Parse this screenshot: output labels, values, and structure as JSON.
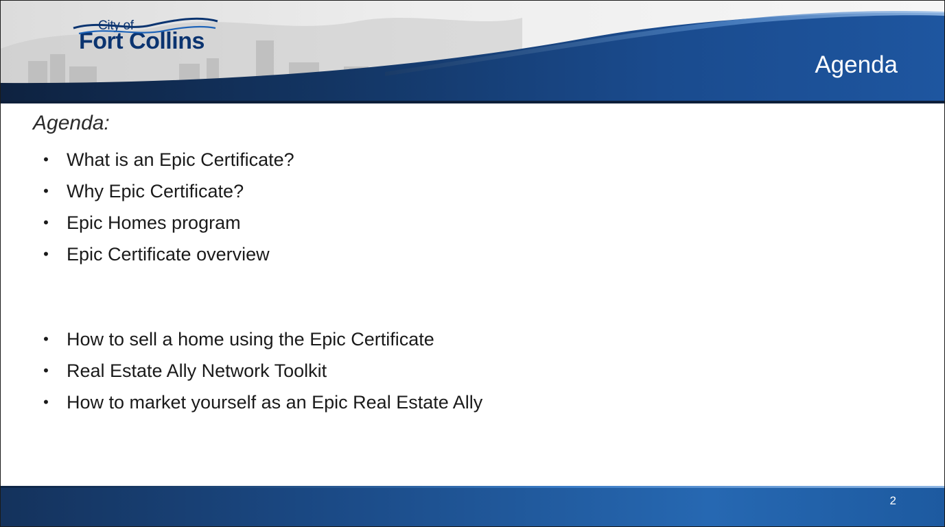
{
  "header": {
    "logo": {
      "small_text": "City of",
      "big_text": "Fort Collins"
    },
    "title": "Agenda"
  },
  "content": {
    "heading": "Agenda:",
    "bullets": [
      "What is an Epic Certificate?",
      "Why Epic Certificate?",
      "Epic Homes program",
      "Epic Certificate overview",
      "How to sell a home using the Epic Certificate",
      "Real Estate Ally Network Toolkit",
      "How to market yourself as an Epic Real Estate Ally"
    ],
    "bullet_symbol": "•"
  },
  "footer": {
    "page_number": "2"
  },
  "colors": {
    "header_navy": "#10264a",
    "header_blue": "#1e56a0",
    "logo_blue": "#0b3470",
    "footer_blue": "#2668b2",
    "text": "#1a1a1a"
  }
}
